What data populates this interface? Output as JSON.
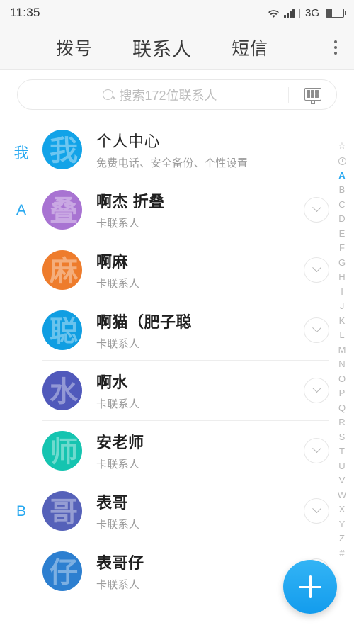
{
  "status": {
    "time": "11:35",
    "network": "3G",
    "wifi_icon": "wifi-icon",
    "signal_icon": "signal-bars-icon",
    "battery_icon": "battery-icon",
    "battery_level_pct": 32
  },
  "tabs": [
    {
      "label": "拨号",
      "active": false
    },
    {
      "label": "联系人",
      "active": true
    },
    {
      "label": "短信",
      "active": false
    }
  ],
  "overflow_menu": {
    "icon": "overflow-menu-icon"
  },
  "search": {
    "placeholder": "搜索172位联系人",
    "value": "",
    "icon": "search-icon",
    "keypad_icon": "dialpad-icon"
  },
  "accent_color": "#27a8f0",
  "sections": [
    {
      "letter": "我",
      "rows": [
        {
          "title": "个人中心",
          "subtitle": "免费电话、安全备份、个性设置",
          "avatar_char": "我",
          "avatar_color": "#12a3e8",
          "has_expand": false,
          "bold_title": false
        }
      ]
    },
    {
      "letter": "A",
      "rows": [
        {
          "title": "啊杰 折叠",
          "subtitle": "卡联系人",
          "avatar_char": "叠",
          "avatar_color": "#a873d2",
          "has_expand": true,
          "bold_title": true
        },
        {
          "title": "啊麻",
          "subtitle": "卡联系人",
          "avatar_char": "麻",
          "avatar_color": "#ee7c2c",
          "has_expand": true,
          "bold_title": true
        },
        {
          "title": "啊猫（肥子聪",
          "subtitle": "卡联系人",
          "avatar_char": "聪",
          "avatar_color": "#109ee2",
          "has_expand": true,
          "bold_title": true
        },
        {
          "title": "啊水",
          "subtitle": "卡联系人",
          "avatar_char": "水",
          "avatar_color": "#5059bb",
          "has_expand": true,
          "bold_title": true
        },
        {
          "title": "安老师",
          "subtitle": "卡联系人",
          "avatar_char": "师",
          "avatar_color": "#15c4b0",
          "has_expand": true,
          "bold_title": true
        }
      ]
    },
    {
      "letter": "B",
      "rows": [
        {
          "title": "表哥",
          "subtitle": "卡联系人",
          "avatar_char": "哥",
          "avatar_color": "#5561b9",
          "has_expand": true,
          "bold_title": true
        },
        {
          "title": "表哥仔",
          "subtitle": "卡联系人",
          "avatar_char": "仔",
          "avatar_color": "#2d7fd0",
          "has_expand": true,
          "bold_title": true
        }
      ]
    }
  ],
  "index_rail": {
    "top_icons": [
      "star-icon",
      "clock-icon"
    ],
    "letters": [
      "A",
      "B",
      "C",
      "D",
      "E",
      "F",
      "G",
      "H",
      "I",
      "J",
      "K",
      "L",
      "M",
      "N",
      "O",
      "P",
      "Q",
      "R",
      "S",
      "T",
      "U",
      "V",
      "W",
      "X",
      "Y",
      "Z",
      "#"
    ],
    "active_letter": "A"
  },
  "fab": {
    "label": "+",
    "icon": "plus-icon",
    "color": "#1aa7f0"
  }
}
